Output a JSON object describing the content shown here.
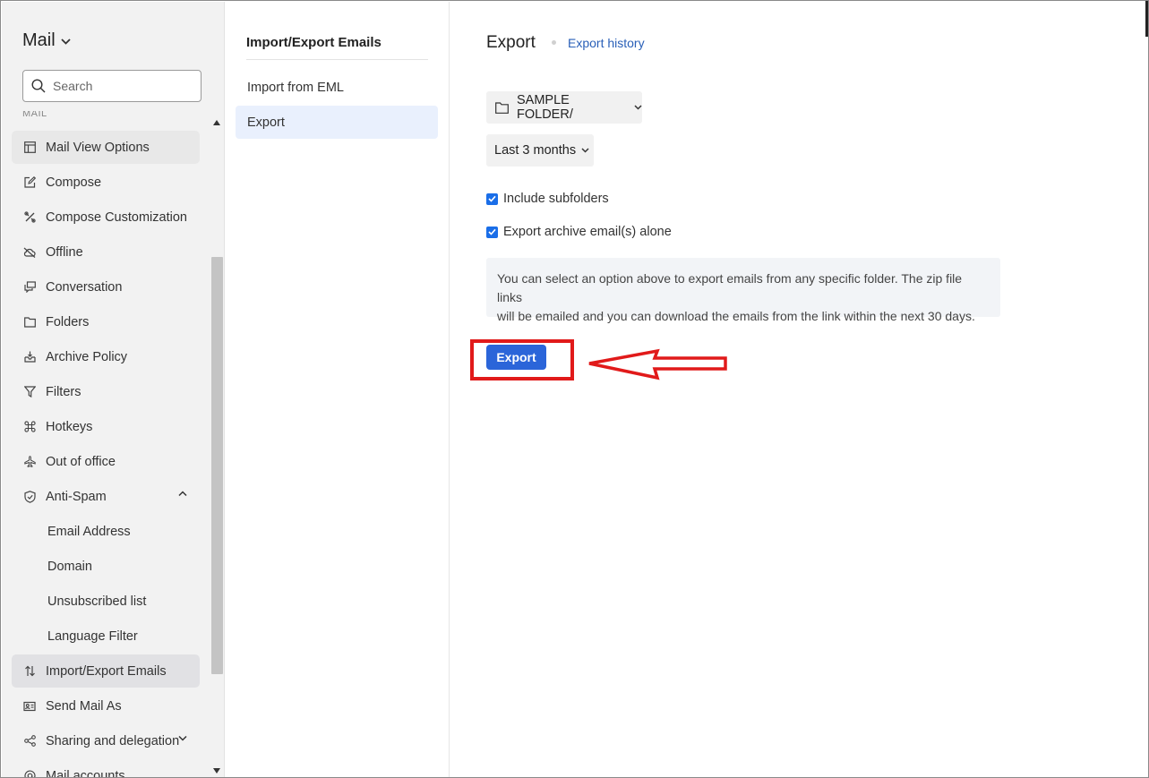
{
  "sidebar": {
    "app_title": "Mail",
    "search": {
      "placeholder": "Search"
    },
    "section_label": "MAIL",
    "items": [
      {
        "label": "Mail View Options",
        "icon": "mail-view-icon"
      },
      {
        "label": "Compose",
        "icon": "compose-icon"
      },
      {
        "label": "Compose Customization",
        "icon": "customize-icon"
      },
      {
        "label": "Offline",
        "icon": "offline-icon"
      },
      {
        "label": "Conversation",
        "icon": "conversation-icon"
      },
      {
        "label": "Folders",
        "icon": "folder-icon"
      },
      {
        "label": "Archive Policy",
        "icon": "archive-icon"
      },
      {
        "label": "Filters",
        "icon": "filter-icon"
      },
      {
        "label": "Hotkeys",
        "icon": "command-key-icon"
      },
      {
        "label": "Out of office",
        "icon": "airplane-icon"
      },
      {
        "label": "Anti-Spam",
        "icon": "shield-icon"
      },
      {
        "label": "Email Address"
      },
      {
        "label": "Domain"
      },
      {
        "label": "Unsubscribed list"
      },
      {
        "label": "Language Filter"
      },
      {
        "label": "Import/Export Emails",
        "icon": "import-export-icon"
      },
      {
        "label": "Send Mail As",
        "icon": "send-as-icon"
      },
      {
        "label": "Sharing and delegation",
        "icon": "share-icon"
      },
      {
        "label": "Mail accounts",
        "icon": "at-icon"
      }
    ]
  },
  "middle": {
    "title": "Import/Export Emails",
    "items": [
      {
        "label": "Import from EML"
      },
      {
        "label": "Export"
      }
    ]
  },
  "main": {
    "heading": "Export",
    "history_link": "Export history",
    "folder_select": "SAMPLE FOLDER/",
    "range_select": "Last 3 months",
    "include_subfolders": "Include subfolders",
    "archive_alone": "Export archive email(s) alone",
    "info_line1": "You can select an option above to export emails from any specific folder. The zip file links",
    "info_line2": "will be emailed and you can download the emails from the link within the next 30 days.",
    "export_button": "Export"
  },
  "colors": {
    "accent": "#2b65d9",
    "highlight": "#e11a1a",
    "link": "#2a60b8",
    "active_nav": "#e1e1e4",
    "active_mid": "#e9f0fd"
  }
}
